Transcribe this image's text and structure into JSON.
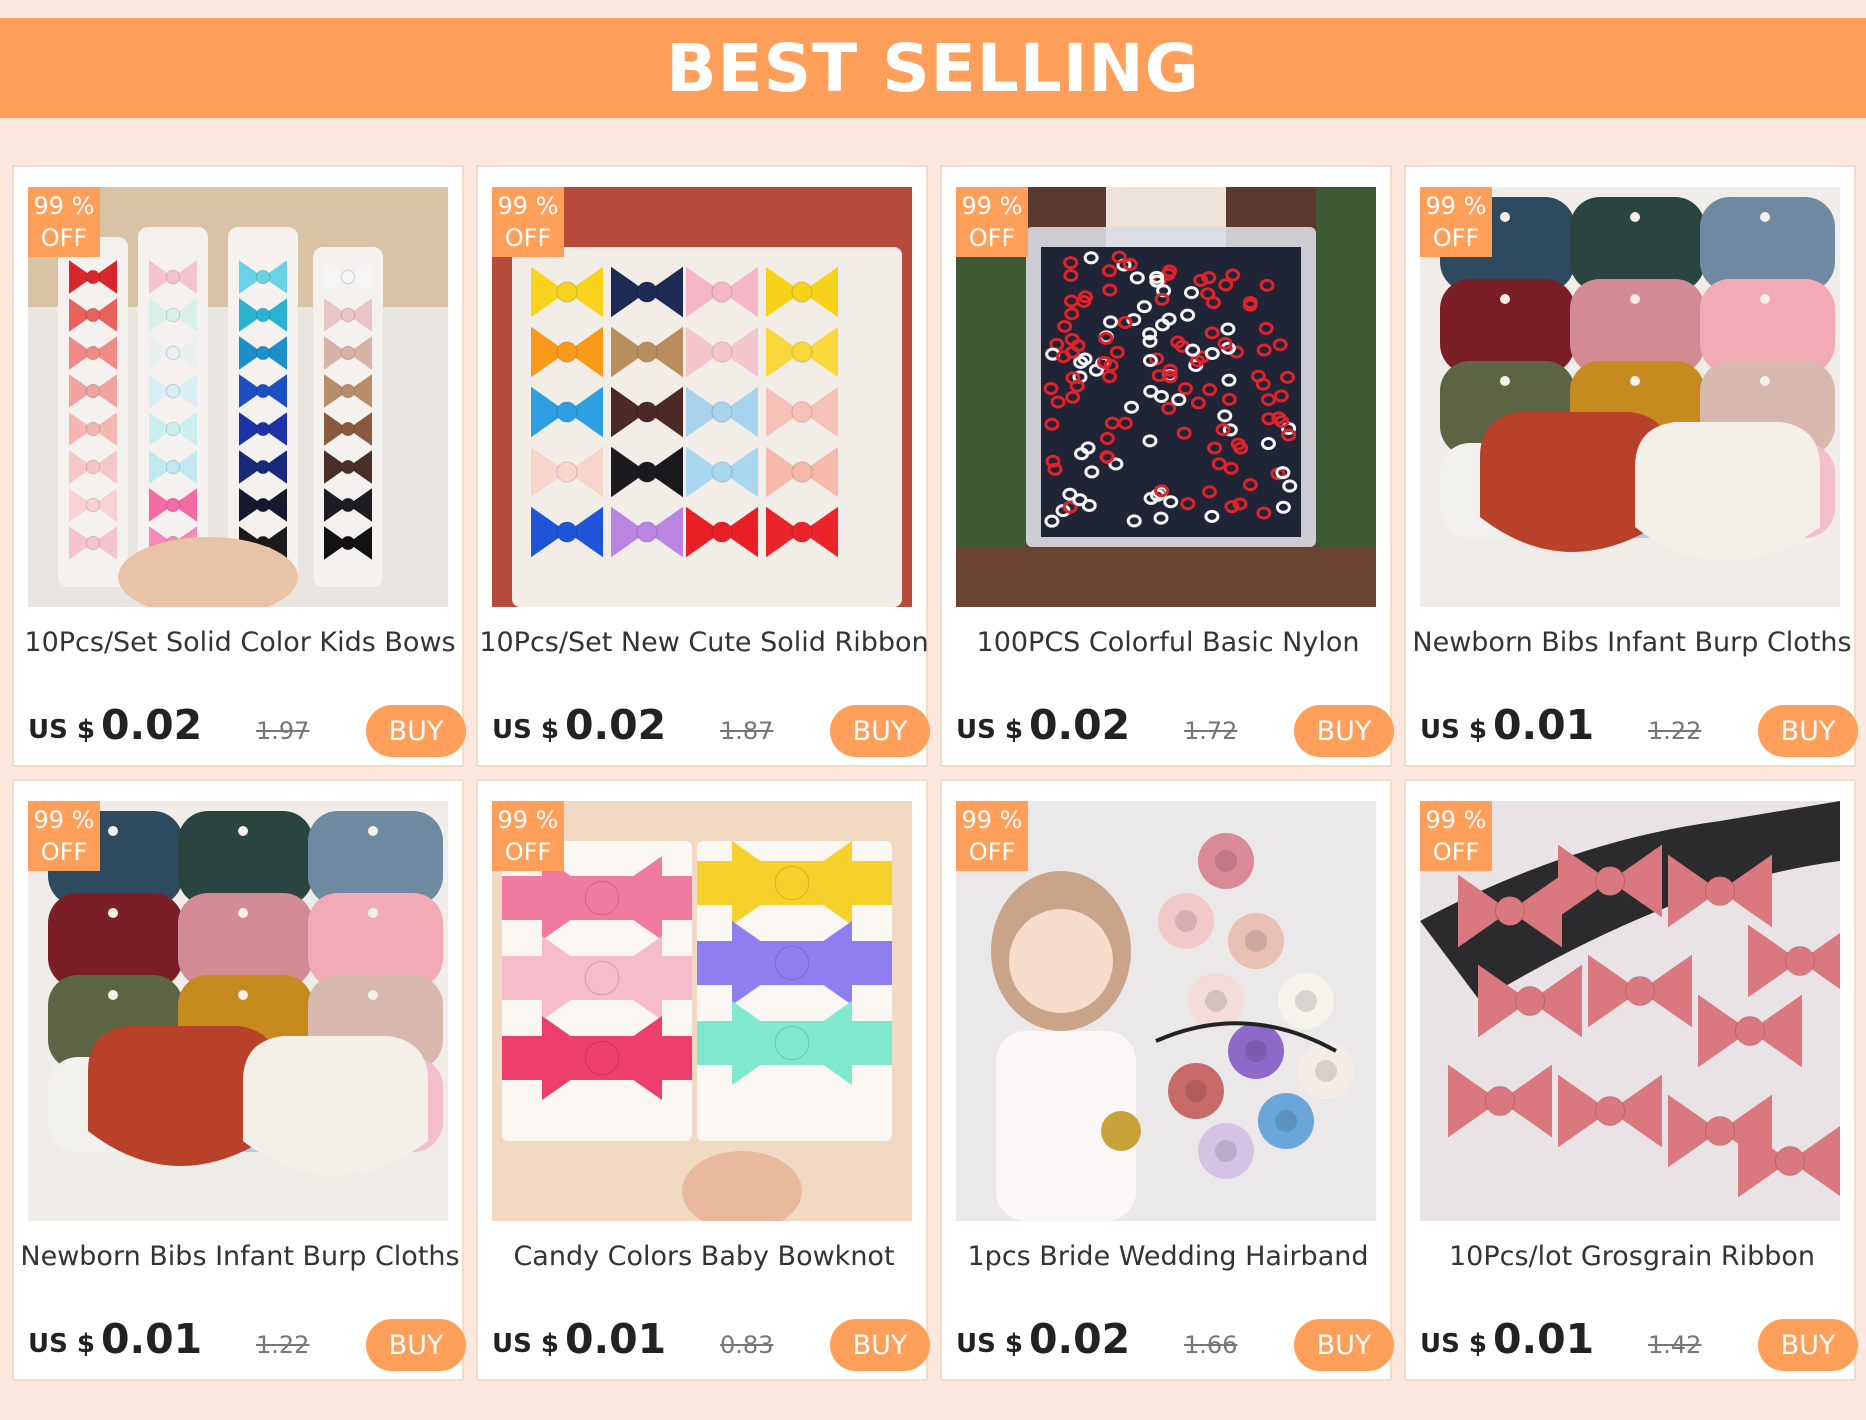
{
  "banner": {
    "title": "BEST SELLING"
  },
  "products": [
    {
      "badge_line1": "99 %",
      "badge_line2": "OFF",
      "title": "10Pcs/Set Solid Color Kids Bows",
      "currency": "US $",
      "price": "0.02",
      "old_price": "1.97",
      "buy_label": "BUY",
      "image": "assorted-bow-clip-cards"
    },
    {
      "badge_line1": "99 %",
      "badge_line2": "OFF",
      "title": "10Pcs/Set New Cute Solid Ribbon",
      "currency": "US $",
      "price": "0.02",
      "old_price": "1.87",
      "buy_label": "BUY",
      "image": "ribbon-bow-clips-card"
    },
    {
      "badge_line1": "99 %",
      "badge_line2": "OFF",
      "title": "100PCS Colorful Basic Nylon",
      "currency": "US $",
      "price": "0.02",
      "old_price": "1.72",
      "buy_label": "BUY",
      "image": "bag-of-hair-ties"
    },
    {
      "badge_line1": "99 %",
      "badge_line2": "OFF",
      "title": "Newborn Bibs Infant Burp Cloths",
      "currency": "US $",
      "price": "0.01",
      "old_price": "1.22",
      "buy_label": "BUY",
      "image": "muslin-bibs"
    },
    {
      "badge_line1": "99 %",
      "badge_line2": "OFF",
      "title": "Newborn Bibs Infant Burp Cloths",
      "currency": "US $",
      "price": "0.01",
      "old_price": "1.22",
      "buy_label": "BUY",
      "image": "muslin-bibs"
    },
    {
      "badge_line1": "99 %",
      "badge_line2": "OFF",
      "title": "Candy Colors Baby Bowknot",
      "currency": "US $",
      "price": "0.01",
      "old_price": "0.83",
      "buy_label": "BUY",
      "image": "baby-bow-headbands"
    },
    {
      "badge_line1": "99 %",
      "badge_line2": "OFF",
      "title": "1pcs Bride Wedding Hairband",
      "currency": "US $",
      "price": "0.02",
      "old_price": "1.66",
      "buy_label": "BUY",
      "image": "flower-hairbands"
    },
    {
      "badge_line1": "99 %",
      "badge_line2": "OFF",
      "title": "10Pcs/lot Grosgrain Ribbon",
      "currency": "US $",
      "price": "0.01",
      "old_price": "1.42",
      "buy_label": "BUY",
      "image": "pink-grosgrain-bows"
    }
  ]
}
